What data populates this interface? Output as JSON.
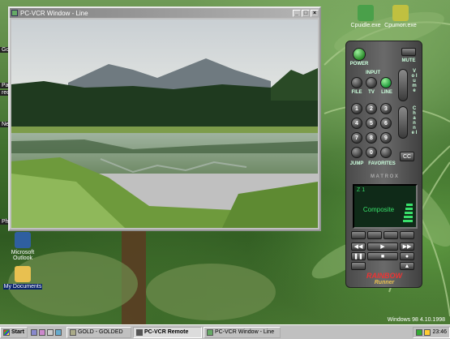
{
  "desktop": {
    "icons_top": [
      {
        "label": "Cpuidle.exe",
        "color": "#4aa04a"
      },
      {
        "label": "Cpumon.exe",
        "color": "#c0c040"
      }
    ],
    "icons_left": [
      {
        "label": "Microsoft Outlook",
        "color": "#2f5fa0"
      },
      {
        "label": "My Documents",
        "color": "#e8c050"
      }
    ],
    "clipped_labels": [
      "Go",
      "Pa",
      "rec",
      "Ne",
      "Phy"
    ],
    "version_text": "Windows 98 4.10.1998"
  },
  "vcr_window": {
    "title": "PC-VCR Window - Line",
    "btn_minimize": "_",
    "btn_maximize": "□",
    "btn_close": "×"
  },
  "remote": {
    "power": "POWER",
    "mute": "MUTE",
    "input_header": "INPUT",
    "file": "FILE",
    "tv": "TV",
    "line": "LINE",
    "volume": "V o l u m e",
    "channel": "C h a n n e l",
    "digits": [
      "1",
      "2",
      "3",
      "4",
      "5",
      "6",
      "7",
      "8",
      "9",
      "0"
    ],
    "cc": "CC",
    "jump": "JUMP",
    "favorites": "FAVORITES",
    "brand_strip": "M A T R O X",
    "lcd_source": "Composite",
    "lcd_top": "Z 1",
    "logo_top": "RAINBOW",
    "logo_bottom": "Runner"
  },
  "taskbar": {
    "start": "Start",
    "tasks": [
      {
        "label": "GOLD - GOLDED",
        "active": false
      },
      {
        "label": "PC-VCR Remote",
        "active": true
      },
      {
        "label": "PC-VCR Window - Line",
        "active": false
      }
    ],
    "clock": "23:46"
  }
}
